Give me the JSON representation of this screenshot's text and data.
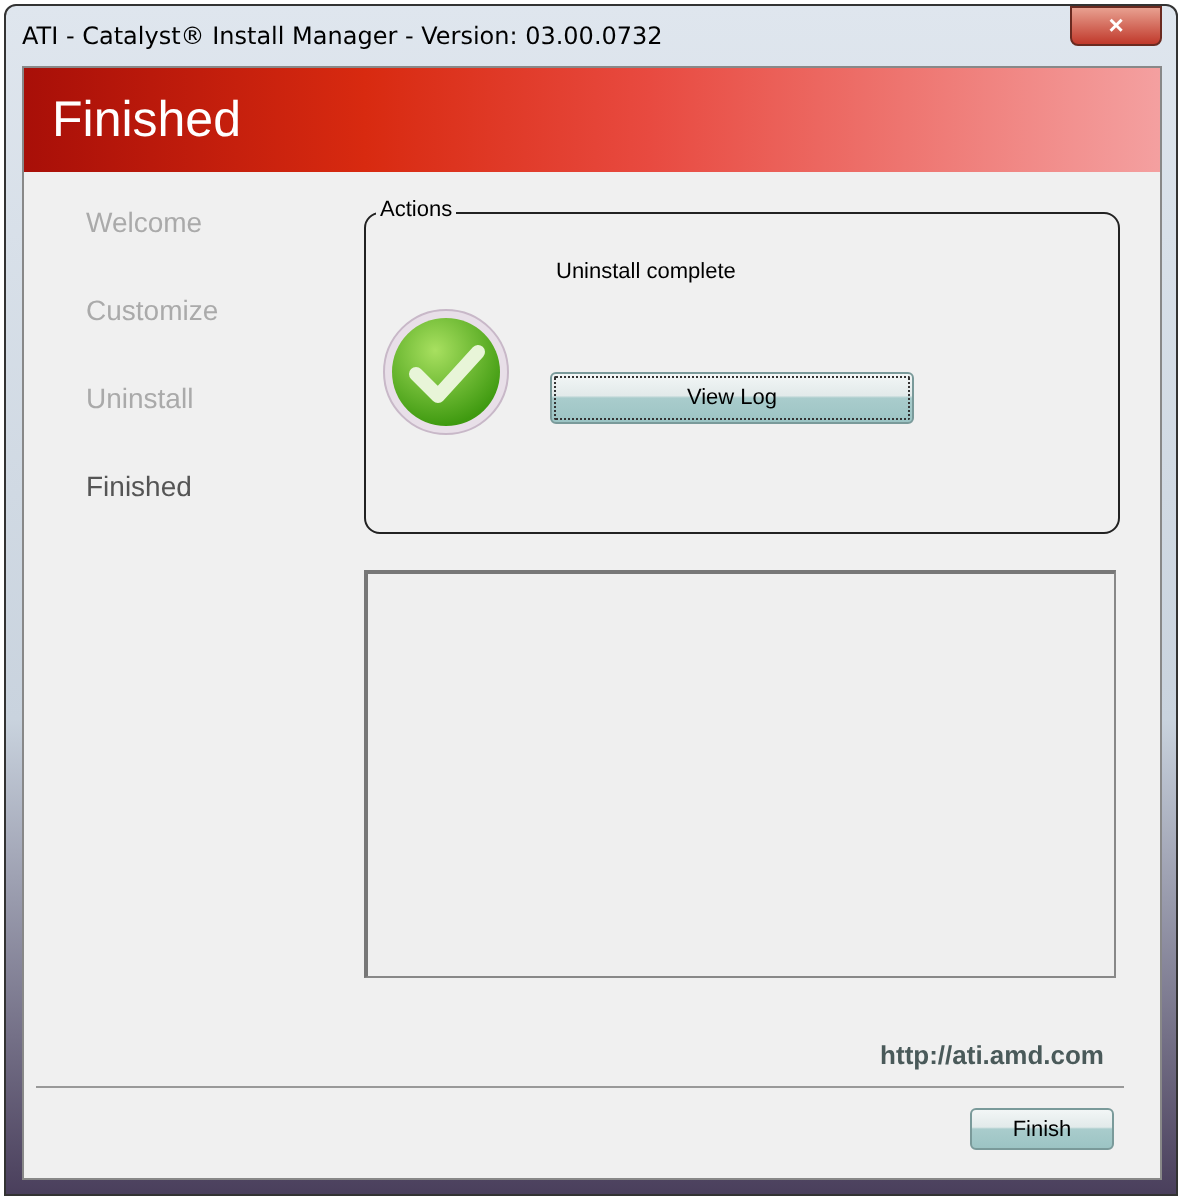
{
  "window": {
    "title": "ATI - Catalyst® Install Manager - Version: 03.00.0732",
    "close": "×"
  },
  "header": {
    "title": "Finished"
  },
  "steps": [
    {
      "label": "Welcome",
      "selected": false
    },
    {
      "label": "Customize",
      "selected": false
    },
    {
      "label": "Uninstall",
      "selected": false
    },
    {
      "label": "Finished",
      "selected": true
    }
  ],
  "actions": {
    "legend": "Actions",
    "status": "Uninstall complete",
    "button": "View Log"
  },
  "link": "http://ati.amd.com",
  "buttons": [
    "Finish"
  ]
}
